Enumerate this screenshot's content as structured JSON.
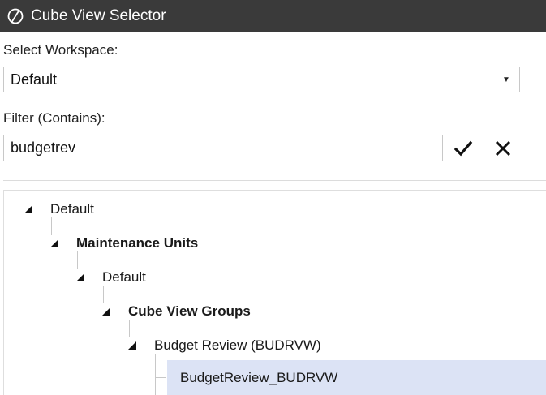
{
  "title": "Cube View Selector",
  "workspace": {
    "label": "Select Workspace:",
    "value": "Default"
  },
  "filter": {
    "label": "Filter (Contains):",
    "value": "budgetrev"
  },
  "tree": {
    "nodes": [
      {
        "label": "Default"
      },
      {
        "label": "Maintenance Units"
      },
      {
        "label": "Default"
      },
      {
        "label": "Cube View Groups"
      },
      {
        "label": "Budget Review (BUDRVW)"
      },
      {
        "label": "BudgetReview_BUDRVW"
      }
    ]
  },
  "icons": {
    "logo": "onestream-logo-icon",
    "dropdown": "caret-down-icon",
    "apply": "checkmark-icon",
    "clear": "close-icon",
    "expand": "expanded-triangle-icon"
  },
  "colors": {
    "titlebar": "#3a3a3a",
    "selection": "#dce3f5"
  }
}
